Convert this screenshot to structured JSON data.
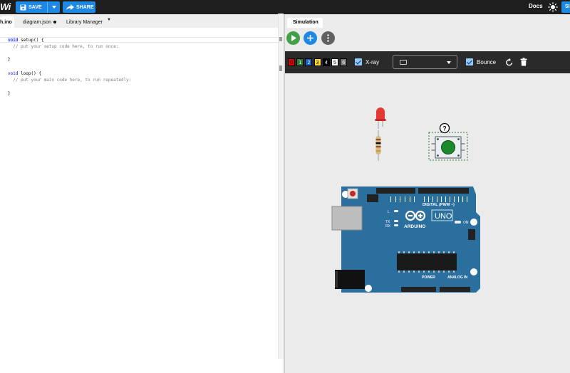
{
  "topbar": {
    "brand": "Wi",
    "save_label": "SAVE",
    "share_label": "SHARE",
    "docs_label": "Docs",
    "cut_label": "SI"
  },
  "editor": {
    "tabs": [
      {
        "label": "h.ino",
        "active": true
      },
      {
        "label": "diagram.json",
        "modified": true
      },
      {
        "label": "Library Manager"
      }
    ],
    "code": {
      "line1_kw": "void",
      "line1_rest": " setup() {",
      "line2": "  // put your setup code here, to run once:",
      "line4": "}",
      "line6_kw": "void",
      "line6_rest": " loop() {",
      "line7": "  // put your main code here, to run repeatedly:",
      "line9": "}"
    }
  },
  "simulation": {
    "tab_label": "Simulation",
    "layers": [
      {
        "label": "0",
        "bg": "#d50000",
        "fg": "#000"
      },
      {
        "label": "1",
        "bg": "#2e7d32",
        "fg": "#fff"
      },
      {
        "label": "2",
        "bg": "#1565c0",
        "fg": "#fff"
      },
      {
        "label": "3",
        "bg": "#fdd835",
        "fg": "#000"
      },
      {
        "label": "4",
        "bg": "#000000",
        "fg": "#fff"
      },
      {
        "label": "5",
        "bg": "#ffffff",
        "fg": "#000"
      },
      {
        "label": "6",
        "bg": "#757575",
        "fg": "#fff"
      }
    ],
    "xray_label": "X-ray",
    "bounce_label": "Bounce",
    "board": {
      "model": "UNO",
      "brand": "ARDUINO",
      "digital_label": "DIGITAL (PWM ~)",
      "analog_label": "ANALOG IN",
      "power_label": "POWER",
      "on_label": "ON",
      "l_label": "L",
      "tx_label": "TX",
      "rx_label": "RX"
    },
    "button_badge": "?"
  },
  "colors": {
    "topbar": "#1e1e1e",
    "accent": "#1e88e5",
    "play": "#43a047",
    "board": "#2a6f9e"
  }
}
